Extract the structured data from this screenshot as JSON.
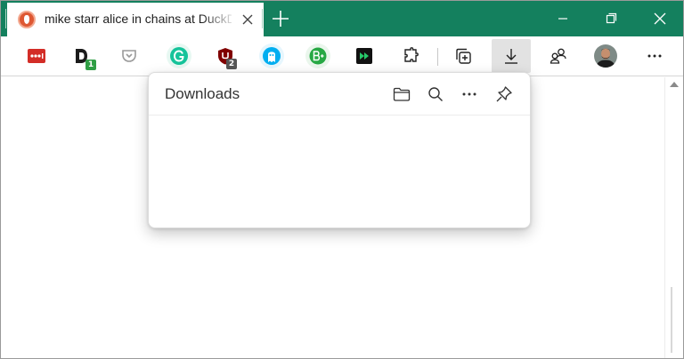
{
  "browser": {
    "tab": {
      "title": "mike starr alice in chains at DuckDuckGo",
      "favicon": "duckduckgo-icon",
      "close": "close-icon"
    },
    "new_tab": "plus-icon",
    "window_controls": [
      "minimize-icon",
      "restore-icon",
      "close-icon"
    ],
    "colors": {
      "titlebar": "#14805e",
      "tab": "#ffffff",
      "duckduckgo": "#de5833"
    }
  },
  "toolbar": {
    "extensions": [
      {
        "name": "lastpass",
        "icon": "lastpass-icon",
        "color": "#d32d27"
      },
      {
        "name": "disconnect",
        "icon": "d-icon",
        "badge": "1",
        "color": "#1b1b1b",
        "badge_color": "#2f9e44"
      },
      {
        "name": "pocket",
        "icon": "pocket-icon",
        "color": "#9a9a9a"
      },
      {
        "name": "grammarly",
        "icon": "grammarly-icon",
        "color": "#15c39a"
      },
      {
        "name": "ublock",
        "icon": "ublock-icon",
        "badge": "2",
        "color": "#800000",
        "badge_color": "#555555"
      },
      {
        "name": "ghostery",
        "icon": "ghostery-icon",
        "color": "#00aef0"
      },
      {
        "name": "blocksite",
        "icon": "b-plus-icon",
        "color": "#27a844"
      },
      {
        "name": "skip",
        "icon": "fast-forward-icon",
        "color": "#111111"
      }
    ],
    "buttons": [
      "extensions-puzzle-icon",
      "collections-icon",
      "download-icon",
      "profile-switch-icon",
      "avatar",
      "more-icon"
    ]
  },
  "downloads": {
    "title": "Downloads",
    "actions": [
      "open-folder-icon",
      "search-icon",
      "more-icon",
      "pin-icon"
    ]
  }
}
